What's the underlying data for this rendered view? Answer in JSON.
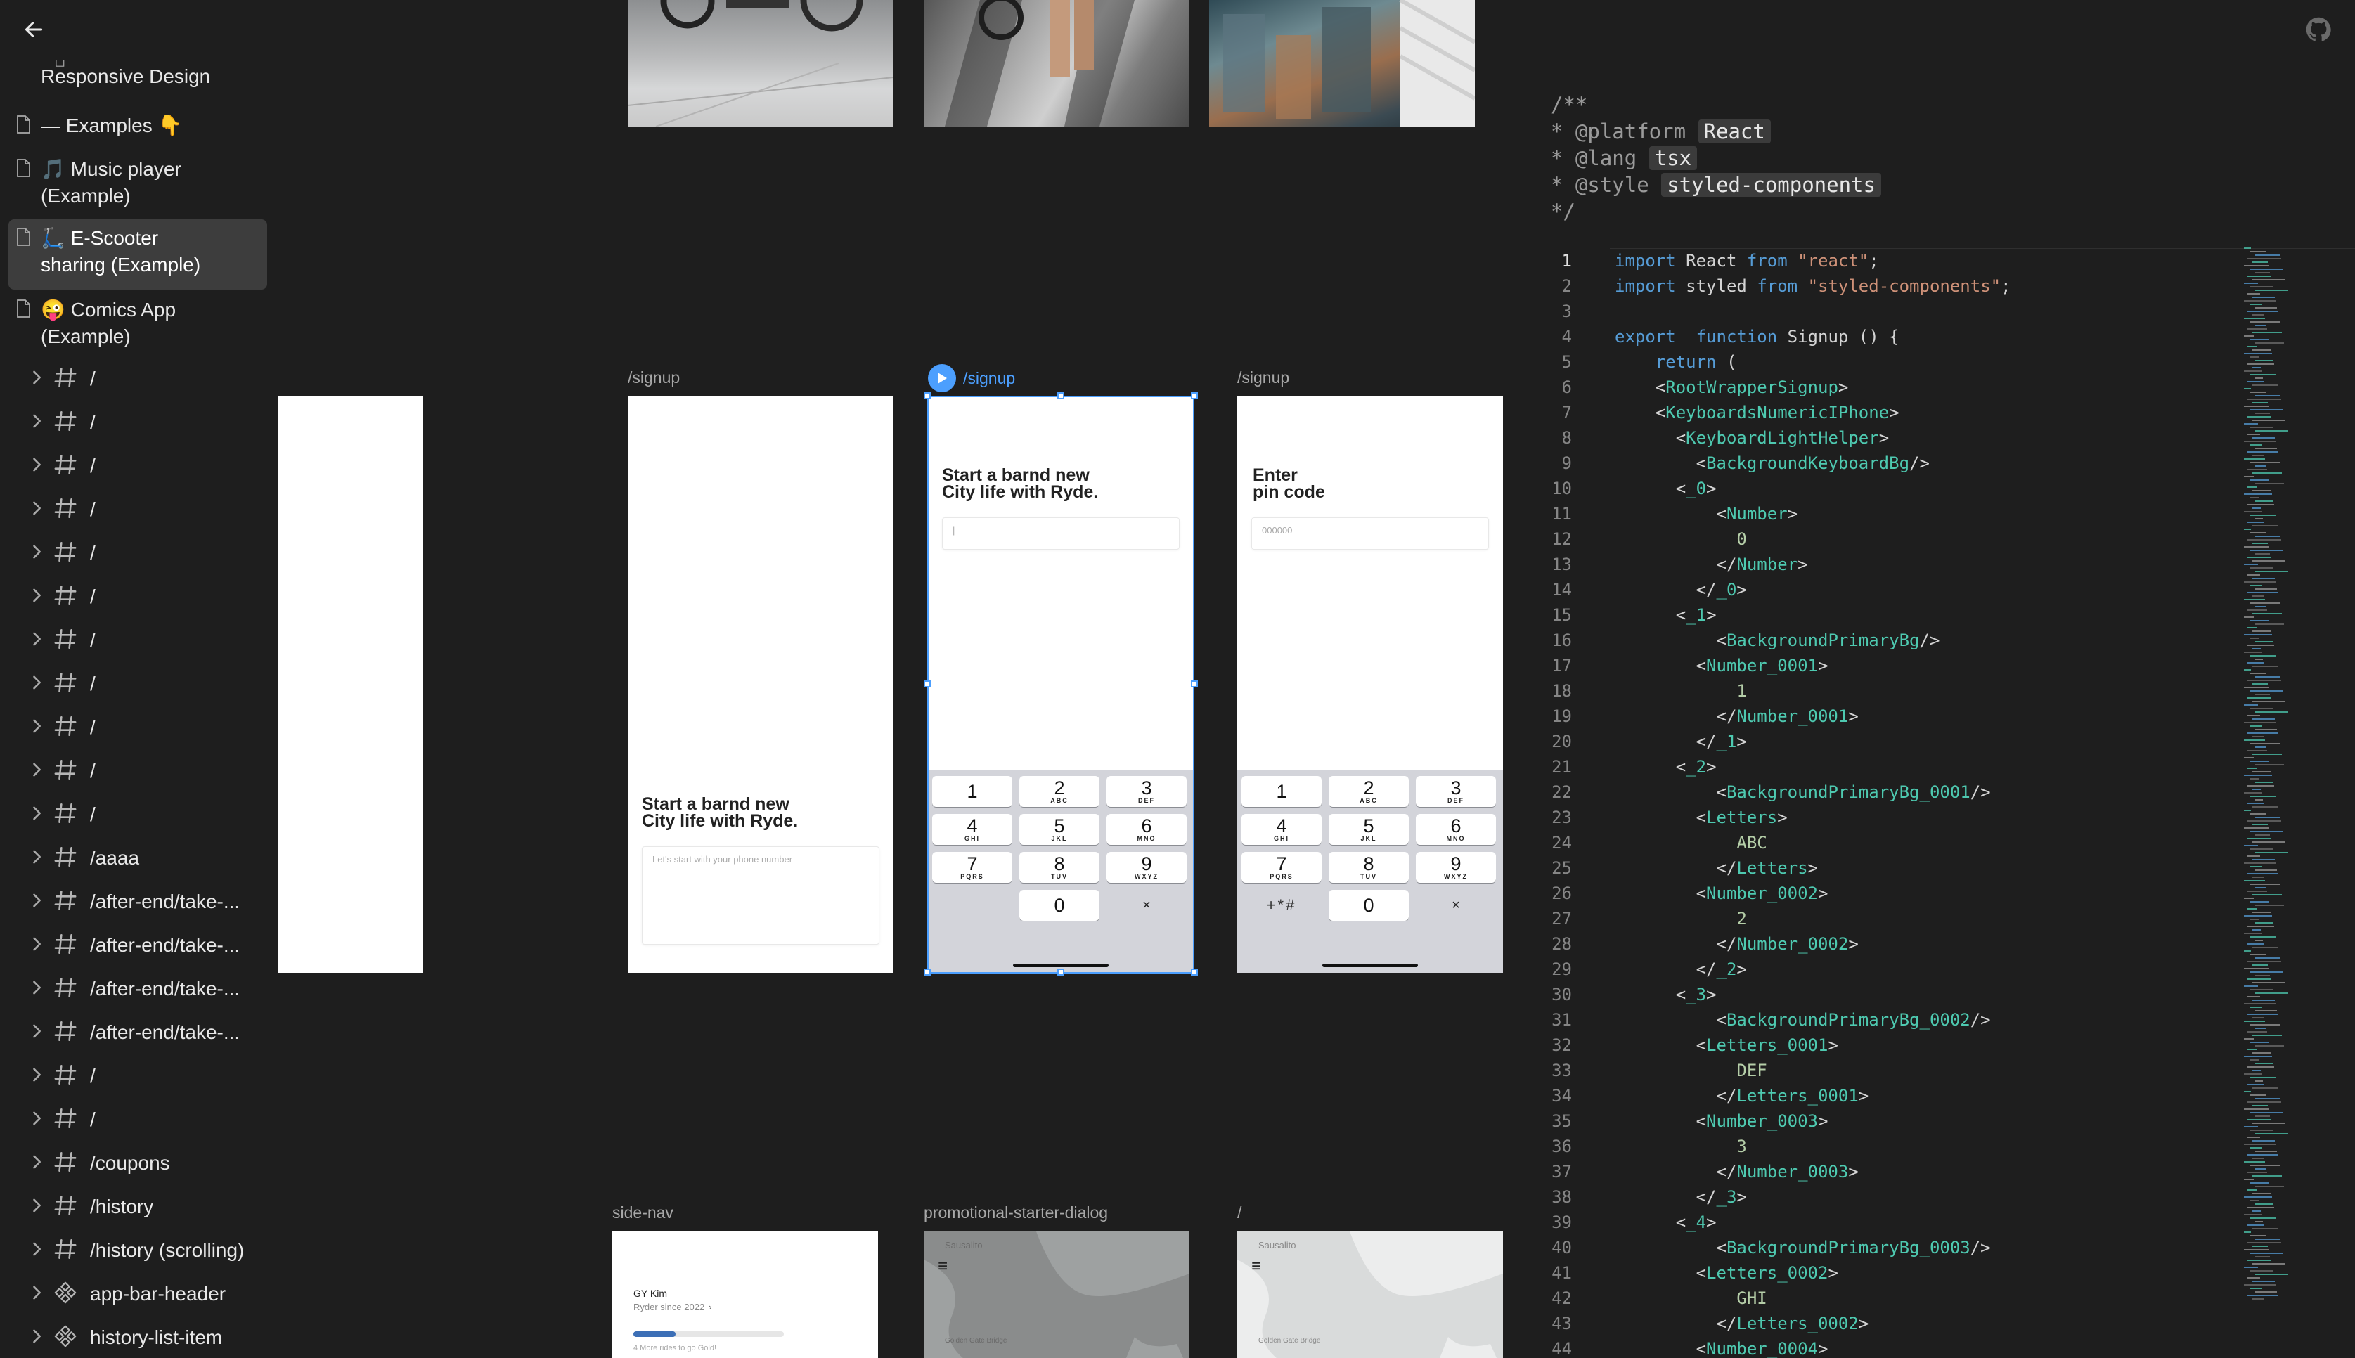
{
  "sidebar": {
    "pages": [
      {
        "label": "Responsive Design",
        "active": false
      },
      {
        "label": "— Examples 👇",
        "active": false
      },
      {
        "label": "🎵 Music player\n(Example)",
        "active": false
      },
      {
        "label": "🛴 E-Scooter\nsharing (Example)",
        "active": true
      },
      {
        "label": "😜 Comics App\n(Example)",
        "active": false
      }
    ],
    "frames": [
      {
        "label": "/",
        "kind": "frame"
      },
      {
        "label": "/",
        "kind": "frame"
      },
      {
        "label": "/",
        "kind": "frame"
      },
      {
        "label": "/",
        "kind": "frame"
      },
      {
        "label": "/",
        "kind": "frame"
      },
      {
        "label": "/",
        "kind": "frame"
      },
      {
        "label": "/",
        "kind": "frame"
      },
      {
        "label": "/",
        "kind": "frame"
      },
      {
        "label": "/",
        "kind": "frame"
      },
      {
        "label": "/",
        "kind": "frame"
      },
      {
        "label": "/",
        "kind": "frame"
      },
      {
        "label": "/aaaa",
        "kind": "frame"
      },
      {
        "label": "/after-end/take-...",
        "kind": "frame"
      },
      {
        "label": "/after-end/take-...",
        "kind": "frame"
      },
      {
        "label": "/after-end/take-...",
        "kind": "frame"
      },
      {
        "label": "/after-end/take-...",
        "kind": "frame"
      },
      {
        "label": "/",
        "kind": "frame"
      },
      {
        "label": "/",
        "kind": "frame"
      },
      {
        "label": "/coupons",
        "kind": "frame"
      },
      {
        "label": "/history",
        "kind": "frame"
      },
      {
        "label": "/history (scrolling)",
        "kind": "frame"
      },
      {
        "label": "app-bar-header",
        "kind": "component"
      },
      {
        "label": "history-list-item",
        "kind": "component"
      }
    ]
  },
  "canvas": {
    "frames_row1": [
      {
        "label": "/signup",
        "headline": "Start a barnd new\nCity life with Ryde.",
        "placeholder": "Let's start with your phone number"
      },
      {
        "label": "/signup",
        "headline": "Start a barnd new\nCity life with Ryde.",
        "placeholder": "|"
      },
      {
        "label": "/signup",
        "headline": "Enter\npin code",
        "placeholder": "000000"
      }
    ],
    "keys": [
      {
        "d": "1",
        "l": ""
      },
      {
        "d": "2",
        "l": "ABC"
      },
      {
        "d": "3",
        "l": "DEF"
      },
      {
        "d": "4",
        "l": "GHI"
      },
      {
        "d": "5",
        "l": "JKL"
      },
      {
        "d": "6",
        "l": "MNO"
      },
      {
        "d": "7",
        "l": "PQRS"
      },
      {
        "d": "8",
        "l": "TUV"
      },
      {
        "d": "9",
        "l": "WXYZ"
      }
    ],
    "zero_key": "0",
    "delete_glyph": "×",
    "symbols_key": "+*#",
    "frames_row2": [
      {
        "label": "side-nav"
      },
      {
        "label": "promotional-starter-dialog"
      },
      {
        "label": "/"
      }
    ],
    "sidenav": {
      "name": "GY Kim",
      "subtitle": "Ryder since 2022",
      "progress": 0.28,
      "progress_text": "4 More rides to go Gold!"
    },
    "map_place": "Sausalito",
    "map_bridge": "Golden Gate Bridge",
    "menu_glyph": "≡"
  },
  "code": {
    "doc": {
      "open": "/**",
      "platform_key": "* @platform",
      "platform_val": "React",
      "lang_key": "* @lang",
      "lang_val": "tsx",
      "style_key": "* @style",
      "style_val": "styled-components",
      "close": "*/"
    },
    "lines": [
      [
        [
          "kw",
          "import "
        ],
        [
          "t",
          "React "
        ],
        [
          "kw",
          "from "
        ],
        [
          "str",
          "\"react\""
        ],
        [
          "t",
          ";"
        ]
      ],
      [
        [
          "kw",
          "import "
        ],
        [
          "t",
          "styled "
        ],
        [
          "kw",
          "from "
        ],
        [
          "str",
          "\"styled-components\""
        ],
        [
          "t",
          ";"
        ]
      ],
      [],
      [
        [
          "kw",
          "export  function "
        ],
        [
          "t",
          "Signup () {"
        ]
      ],
      [
        [
          "t",
          "    "
        ],
        [
          "kw",
          "return "
        ],
        [
          "t",
          "("
        ]
      ],
      [
        [
          "t",
          "    <"
        ],
        [
          "jsx",
          "RootWrapperSignup"
        ],
        [
          "t",
          ">"
        ]
      ],
      [
        [
          "t",
          "    <"
        ],
        [
          "jsx",
          "KeyboardsNumericIPhone"
        ],
        [
          "t",
          ">"
        ]
      ],
      [
        [
          "t",
          "      <"
        ],
        [
          "jsx",
          "KeyboardLightHelper"
        ],
        [
          "t",
          ">"
        ]
      ],
      [
        [
          "t",
          "        <"
        ],
        [
          "jsx",
          "BackgroundKeyboardBg"
        ],
        [
          "t",
          "/>"
        ]
      ],
      [
        [
          "t",
          "      <"
        ],
        [
          "jsx",
          "_0"
        ],
        [
          "t",
          ">"
        ]
      ],
      [
        [
          "t",
          "          <"
        ],
        [
          "jsx",
          "Number"
        ],
        [
          "t",
          ">"
        ]
      ],
      [
        [
          "t",
          "            "
        ],
        [
          "txt",
          "0"
        ]
      ],
      [
        [
          "t",
          "          </"
        ],
        [
          "jsx",
          "Number"
        ],
        [
          "t",
          ">"
        ]
      ],
      [
        [
          "t",
          "        </"
        ],
        [
          "jsx",
          "_0"
        ],
        [
          "t",
          ">"
        ]
      ],
      [
        [
          "t",
          "      <"
        ],
        [
          "jsx",
          "_1"
        ],
        [
          "t",
          ">"
        ]
      ],
      [
        [
          "t",
          "          <"
        ],
        [
          "jsx",
          "BackgroundPrimaryBg"
        ],
        [
          "t",
          "/>"
        ]
      ],
      [
        [
          "t",
          "        <"
        ],
        [
          "jsx",
          "Number_0001"
        ],
        [
          "t",
          ">"
        ]
      ],
      [
        [
          "t",
          "            "
        ],
        [
          "txt",
          "1"
        ]
      ],
      [
        [
          "t",
          "          </"
        ],
        [
          "jsx",
          "Number_0001"
        ],
        [
          "t",
          ">"
        ]
      ],
      [
        [
          "t",
          "        </"
        ],
        [
          "jsx",
          "_1"
        ],
        [
          "t",
          ">"
        ]
      ],
      [
        [
          "t",
          "      <"
        ],
        [
          "jsx",
          "_2"
        ],
        [
          "t",
          ">"
        ]
      ],
      [
        [
          "t",
          "          <"
        ],
        [
          "jsx",
          "BackgroundPrimaryBg_0001"
        ],
        [
          "t",
          "/>"
        ]
      ],
      [
        [
          "t",
          "        <"
        ],
        [
          "jsx",
          "Letters"
        ],
        [
          "t",
          ">"
        ]
      ],
      [
        [
          "t",
          "            "
        ],
        [
          "txt",
          "ABC"
        ]
      ],
      [
        [
          "t",
          "          </"
        ],
        [
          "jsx",
          "Letters"
        ],
        [
          "t",
          ">"
        ]
      ],
      [
        [
          "t",
          "        <"
        ],
        [
          "jsx",
          "Number_0002"
        ],
        [
          "t",
          ">"
        ]
      ],
      [
        [
          "t",
          "            "
        ],
        [
          "txt",
          "2"
        ]
      ],
      [
        [
          "t",
          "          </"
        ],
        [
          "jsx",
          "Number_0002"
        ],
        [
          "t",
          ">"
        ]
      ],
      [
        [
          "t",
          "        </"
        ],
        [
          "jsx",
          "_2"
        ],
        [
          "t",
          ">"
        ]
      ],
      [
        [
          "t",
          "      <"
        ],
        [
          "jsx",
          "_3"
        ],
        [
          "t",
          ">"
        ]
      ],
      [
        [
          "t",
          "          <"
        ],
        [
          "jsx",
          "BackgroundPrimaryBg_0002"
        ],
        [
          "t",
          "/>"
        ]
      ],
      [
        [
          "t",
          "        <"
        ],
        [
          "jsx",
          "Letters_0001"
        ],
        [
          "t",
          ">"
        ]
      ],
      [
        [
          "t",
          "            "
        ],
        [
          "txt",
          "DEF"
        ]
      ],
      [
        [
          "t",
          "          </"
        ],
        [
          "jsx",
          "Letters_0001"
        ],
        [
          "t",
          ">"
        ]
      ],
      [
        [
          "t",
          "        <"
        ],
        [
          "jsx",
          "Number_0003"
        ],
        [
          "t",
          ">"
        ]
      ],
      [
        [
          "t",
          "            "
        ],
        [
          "txt",
          "3"
        ]
      ],
      [
        [
          "t",
          "          </"
        ],
        [
          "jsx",
          "Number_0003"
        ],
        [
          "t",
          ">"
        ]
      ],
      [
        [
          "t",
          "        </"
        ],
        [
          "jsx",
          "_3"
        ],
        [
          "t",
          ">"
        ]
      ],
      [
        [
          "t",
          "      <"
        ],
        [
          "jsx",
          "_4"
        ],
        [
          "t",
          ">"
        ]
      ],
      [
        [
          "t",
          "          <"
        ],
        [
          "jsx",
          "BackgroundPrimaryBg_0003"
        ],
        [
          "t",
          "/>"
        ]
      ],
      [
        [
          "t",
          "        <"
        ],
        [
          "jsx",
          "Letters_0002"
        ],
        [
          "t",
          ">"
        ]
      ],
      [
        [
          "t",
          "            "
        ],
        [
          "txt",
          "GHI"
        ]
      ],
      [
        [
          "t",
          "          </"
        ],
        [
          "jsx",
          "Letters_0002"
        ],
        [
          "t",
          ">"
        ]
      ],
      [
        [
          "t",
          "        <"
        ],
        [
          "jsx",
          "Number_0004"
        ],
        [
          "t",
          ">"
        ]
      ]
    ]
  },
  "colors": {
    "accent": "#4c9ffe",
    "background": "#1e1e1e",
    "active_page": "#3d3d3d",
    "keyword": "#569cd6",
    "string": "#ce9178",
    "jsx_tag": "#4ec9b0"
  },
  "icons": {
    "back": "arrow-left-icon",
    "github": "github-icon",
    "page": "file-icon",
    "frame": "hash-icon",
    "component": "component-icon",
    "chevron": "chevron-right-icon",
    "play": "play-icon"
  }
}
